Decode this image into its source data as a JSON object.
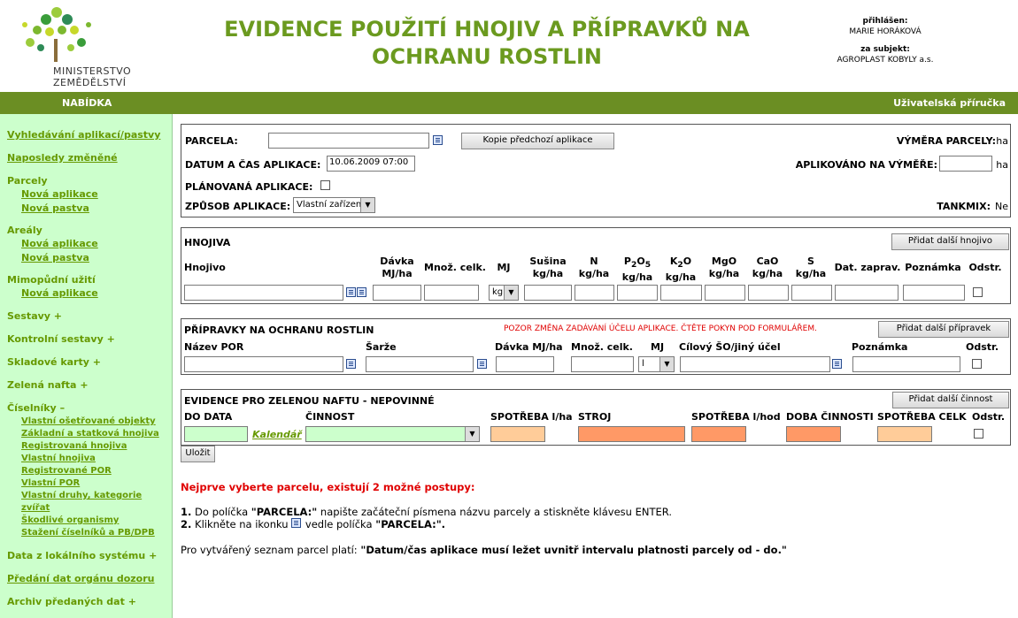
{
  "header": {
    "title_line1": "EVIDENCE POUŽITÍ HNOJIV A PŘÍPRAVKŮ NA",
    "title_line2": "OCHRANU ROSTLIN",
    "logo_text": "MINISTERSTVO ZEMĚDĚLSTVÍ",
    "logged_label": "přihlášen:",
    "logged_user": "MARIE HORÁKOVÁ",
    "subject_label": "za subjekt:",
    "subject_name": "AGROPLAST KOBYLY a.s."
  },
  "menubar": {
    "menu_label": "NABÍDKA",
    "manual_label": "Uživatelská příručka"
  },
  "sidebar": {
    "search": "Vyhledávání aplikací/pastvy",
    "recent": "Naposledy změněné",
    "parcely": "Parcely",
    "parcely_new_app": "Nová aplikace",
    "parcely_new_pasture": "Nová pastva",
    "arealy": "Areály",
    "arealy_new_app": "Nová aplikace",
    "arealy_new_pasture": "Nová pastva",
    "mimopudni": "Mimopůdní užití",
    "mimopudni_new_app": "Nová aplikace",
    "sestavy": "Sestavy",
    "kontrolni": "Kontrolní sestavy",
    "skladove": "Skladové karty",
    "zelena": "Zelená nafta",
    "ciselniky": "Číselníky",
    "c1": "Vlastní ošetřované objekty",
    "c2": "Základní a statková hnojiva",
    "c3": "Registrovaná hnojiva",
    "c4": "Vlastní hnojiva",
    "c5": "Registrované POR",
    "c6": "Vlastní POR",
    "c7": "Vlastní druhy, kategorie zvířat",
    "c8": "Škodlivé organismy",
    "c9": "Stažení číselníků a PB/DPB",
    "data_local": "Data z lokálního systému",
    "predani": "Předání dat orgánu dozoru",
    "archiv": "Archiv předaných dat",
    "plus": "+",
    "minus": "–"
  },
  "app": {
    "parcela_label": "PARCELA:",
    "copy_btn": "Kopie předchozí aplikace",
    "vymera_label": "VÝMĚRA PARCELY:",
    "vymera_unit": "ha",
    "datum_label": "DATUM A ČAS APLIKACE:",
    "datum_value": "10.06.2009 07:00",
    "aplikovano_label": "APLIKOVÁNO NA VÝMĚŘE:",
    "aplikovano_unit": "ha",
    "planovana_label": "PLÁNOVANÁ APLIKACE:",
    "zpusob_label": "ZPŮSOB APLIKACE:",
    "zpusob_value": "Vlastní zařízení",
    "tankmix_label": "TANKMIX:",
    "tankmix_value": "Ne"
  },
  "hnojiva": {
    "title": "HNOJIVA",
    "add_btn": "Přidat další hnojivo",
    "col_hnojivo": "Hnojivo",
    "col_davka": [
      "Dávka",
      "MJ/ha"
    ],
    "col_mnoz": "Množ. celk.",
    "col_mj": "MJ",
    "col_susina": [
      "Sušina",
      "kg/ha"
    ],
    "col_n": [
      "N",
      "kg/ha"
    ],
    "col_p2o5": [
      "P",
      "2",
      "O",
      "5",
      "kg/ha"
    ],
    "col_k2o": [
      "K",
      "2",
      "O",
      "kg/ha"
    ],
    "col_mgo": [
      "MgO",
      "kg/ha"
    ],
    "col_cao": [
      "CaO",
      "kg/ha"
    ],
    "col_s": [
      "S",
      "kg/ha"
    ],
    "col_dat": "Dat. zaprav.",
    "col_pozn": "Poznámka",
    "col_odstr": "Odstr.",
    "mj_value": "kg"
  },
  "por": {
    "title": "PŘÍPRAVKY NA OCHRANU ROSTLIN",
    "warning": "POZOR ZMĚNA ZADÁVÁNÍ ÚČELU APLIKACE. ČTĚTE POKYN POD FORMULÁŘEM.",
    "add_btn": "Přidat další přípravek",
    "col_nazev": "Název POR",
    "col_sarze": "Šarže",
    "col_davka": "Dávka MJ/ha",
    "col_mnoz": "Množ. celk.",
    "col_mj": "MJ",
    "col_cil": "Cílový ŠO/jiný účel",
    "col_pozn": "Poznámka",
    "col_odstr": "Odstr.",
    "mj_value": "l"
  },
  "nafta": {
    "title": "EVIDENCE PRO ZELENOU NAFTU - NEPOVINNÉ",
    "add_btn": "Přidat další činnost",
    "col_do": "DO DATA",
    "col_cinnost": "ČINNOST",
    "col_spotreba_ha": "SPOTŘEBA l/ha",
    "col_stroj": "STROJ",
    "col_spotreba_hod": "SPOTŘEBA l/hod",
    "col_doba": "DOBA ČINNOSTI",
    "col_spotreba_celk": "SPOTŘEBA CELK",
    "col_odstr": "Odstr.",
    "kalendar": "Kalendář"
  },
  "save_btn": "Uložit",
  "instructions": {
    "heading": "Nejprve vyberte parcelu, existují 2 možné postupy:",
    "step1_num": "1.",
    "step1_a": "Do políčka ",
    "step1_b": "\"PARCELA:\"",
    "step1_c": " napište začáteční písmena názvu parcely a stiskněte klávesu ENTER.",
    "step2_num": "2.",
    "step2_a": "Klikněte na ikonku ",
    "step2_b": " vedle políčka ",
    "step2_c": "\"PARCELA:\".",
    "rule_a": "Pro vytvářený seznam parcel platí: ",
    "rule_b": "\"Datum/čas aplikace musí ležet uvnitř intervalu platnosti parcely od - do.\""
  }
}
